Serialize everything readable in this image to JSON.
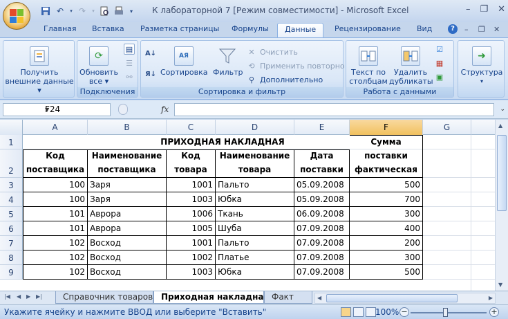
{
  "window": {
    "title": "К лабораторной 7  [Режим совместимости] - Microsoft Excel"
  },
  "ribbon_tabs": [
    {
      "label": "Главная"
    },
    {
      "label": "Вставка"
    },
    {
      "label": "Разметка страницы"
    },
    {
      "label": "Формулы"
    },
    {
      "label": "Данные",
      "active": true
    },
    {
      "label": "Рецензирование"
    },
    {
      "label": "Вид"
    }
  ],
  "ribbon": {
    "external_data": {
      "label": "Получить внешние данные",
      "line1": "Получить",
      "line2": "внешние данные"
    },
    "connections": {
      "refresh_line1": "Обновить",
      "refresh_line2": "все",
      "group_label": "Подключения"
    },
    "sort_filter": {
      "sort_label": "Сортировка",
      "filter_label": "Фильтр",
      "clear_label": "Очистить",
      "reapply_label": "Применить повторно",
      "advanced_label": "Дополнительно",
      "group_label": "Сортировка и фильтр"
    },
    "data_tools": {
      "text_to_columns_line1": "Текст по",
      "text_to_columns_line2": "столбцам",
      "remove_dupes_line1": "Удалить",
      "remove_dupes_line2": "дубликаты",
      "group_label": "Работа с данными"
    },
    "outline": {
      "label": "Структура"
    }
  },
  "formula_bar": {
    "name_box": "F24",
    "fx": "fx",
    "formula": ""
  },
  "columns": [
    "A",
    "B",
    "C",
    "D",
    "E",
    "F",
    "G"
  ],
  "selected_column": "F",
  "row_numbers": [
    "1",
    "2",
    "3",
    "4",
    "5",
    "6",
    "7",
    "8",
    "9"
  ],
  "sheet": {
    "title": "ПРИХОДНАЯ НАКЛАДНАЯ",
    "headers": [
      "Код поставщика",
      "Наименование поставщика",
      "Код товара",
      "Наименование товара",
      "Дата поставки",
      "Сумма поставки фактическая"
    ],
    "rows": [
      [
        "100",
        "Заря",
        "1001",
        "Пальто",
        "05.09.2008",
        "500"
      ],
      [
        "100",
        "Заря",
        "1003",
        "Юбка",
        "05.09.2008",
        "700"
      ],
      [
        "101",
        "Аврора",
        "1006",
        "Ткань",
        "06.09.2008",
        "300"
      ],
      [
        "101",
        "Аврора",
        "1005",
        "Шуба",
        "07.09.2008",
        "400"
      ],
      [
        "102",
        "Восход",
        "1001",
        "Пальто",
        "07.09.2008",
        "200"
      ],
      [
        "102",
        "Восход",
        "1002",
        "Платье",
        "07.09.2008",
        "300"
      ],
      [
        "102",
        "Восход",
        "1003",
        "Юбка",
        "07.09.2008",
        "500"
      ]
    ]
  },
  "sheet_tabs": [
    {
      "label": "Справочник товаров"
    },
    {
      "label": "Приходная накладная",
      "active": true
    },
    {
      "label": "Факт"
    }
  ],
  "status": {
    "message": "Укажите ячейку и нажмите ВВОД или выберите \"Вставить\"",
    "zoom": "100%",
    "zoom_minus": "−",
    "zoom_plus": "+"
  },
  "colors": {
    "selected_column_header": "#f1c15f",
    "ribbon_bg": "#dae7f7",
    "text_blue": "#15428b"
  }
}
